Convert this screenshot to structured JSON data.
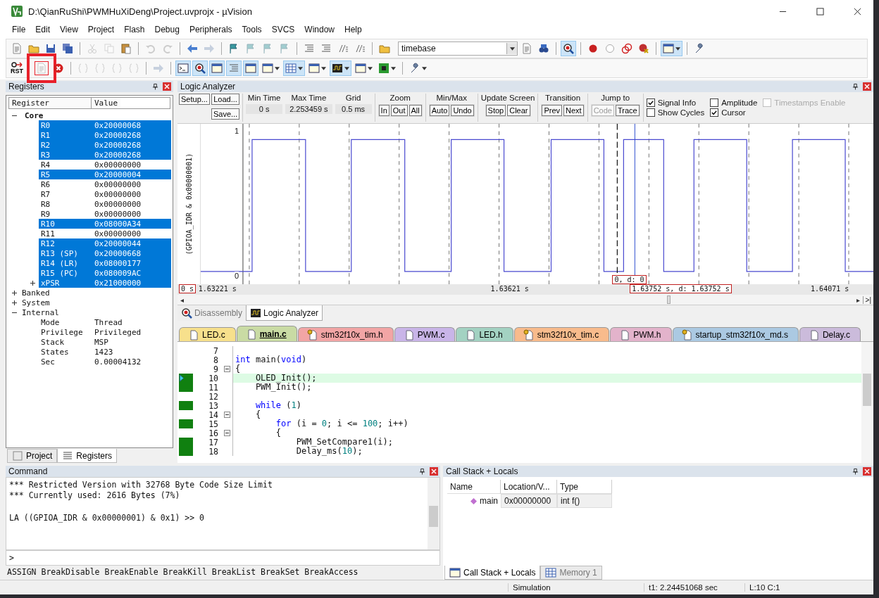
{
  "window": {
    "title": "D:\\QianRuShi\\PWMHuXiDeng\\Project.uvprojx - µVision"
  },
  "menu": [
    "File",
    "Edit",
    "View",
    "Project",
    "Flash",
    "Debug",
    "Peripherals",
    "Tools",
    "SVCS",
    "Window",
    "Help"
  ],
  "toolbar_1": [
    {
      "buttons": [
        {
          "kind": "plain",
          "pressed": false,
          "disabled": false
        },
        {
          "kind": "plain",
          "pressed": false,
          "disabled": false
        },
        {
          "kind": "plain",
          "pressed": false,
          "disabled": false
        },
        {
          "kind": "plain",
          "pressed": false,
          "disabled": false
        }
      ]
    },
    {
      "buttons": [
        {
          "kind": "plain",
          "pressed": false,
          "disabled": true
        },
        {
          "kind": "plain",
          "pressed": false,
          "disabled": true
        },
        {
          "kind": "plain",
          "pressed": false,
          "disabled": false
        }
      ]
    },
    {
      "buttons": [
        {
          "kind": "plain",
          "pressed": false,
          "disabled": true
        },
        {
          "kind": "plain",
          "pressed": false,
          "disabled": true
        }
      ]
    },
    {
      "buttons": [
        {
          "kind": "plain",
          "pressed": false,
          "disabled": false
        },
        {
          "kind": "plain",
          "pressed": false,
          "disabled": true
        }
      ]
    },
    {
      "buttons": [
        {
          "kind": "plain",
          "pressed": false,
          "disabled": false
        },
        {
          "kind": "plain",
          "pressed": false,
          "disabled": true
        },
        {
          "kind": "plain",
          "pressed": false,
          "disabled": true
        },
        {
          "kind": "plain",
          "pressed": false,
          "disabled": true
        }
      ]
    },
    {
      "buttons": [
        {
          "kind": "plain",
          "pressed": false,
          "disabled": false
        },
        {
          "kind": "plain",
          "pressed": false,
          "disabled": false
        },
        {
          "kind": "plain",
          "pressed": false,
          "disabled": false
        },
        {
          "kind": "plain",
          "pressed": false,
          "disabled": false
        }
      ]
    },
    {
      "buttons": [
        {
          "kind": "plain",
          "pressed": false,
          "disabled": false
        },
        {
          "kind": "field",
          "value": "timebase"
        },
        {
          "kind": "plain",
          "pressed": false,
          "disabled": false
        },
        {
          "kind": "plain",
          "pressed": false,
          "disabled": false
        }
      ]
    },
    {
      "buttons": [
        {
          "kind": "plain",
          "pressed": true,
          "disabled": false
        }
      ]
    },
    {
      "buttons": [
        {
          "kind": "plain",
          "pressed": false,
          "disabled": false
        },
        {
          "kind": "plain",
          "pressed": false,
          "disabled": false
        },
        {
          "kind": "plain",
          "pressed": false,
          "disabled": false
        },
        {
          "kind": "plain",
          "pressed": false,
          "disabled": false
        }
      ]
    },
    {
      "buttons": [
        {
          "kind": "split",
          "pressed": true,
          "disabled": false
        }
      ]
    },
    {
      "buttons": [
        {
          "kind": "plain",
          "pressed": false,
          "disabled": false
        }
      ]
    }
  ],
  "toolbar_2": [
    {
      "buttons": [
        {
          "kind": "labelled",
          "label": "RST",
          "pressed": false,
          "disabled": false,
          "highlighted": false
        }
      ]
    },
    {
      "buttons": [
        {
          "kind": "plain",
          "pressed": false,
          "disabled": true,
          "highlighted": true
        },
        {
          "kind": "plain",
          "pressed": false,
          "disabled": false,
          "highlighted": false
        }
      ]
    },
    {
      "buttons": [
        {
          "kind": "plain",
          "pressed": false,
          "disabled": true,
          "highlighted": false
        },
        {
          "kind": "plain",
          "pressed": false,
          "disabled": true,
          "highlighted": false
        },
        {
          "kind": "plain",
          "pressed": false,
          "disabled": true,
          "highlighted": false
        },
        {
          "kind": "plain",
          "pressed": false,
          "disabled": true,
          "highlighted": false
        }
      ]
    },
    {
      "buttons": [
        {
          "kind": "plain",
          "pressed": false,
          "disabled": true,
          "highlighted": false
        }
      ]
    },
    {
      "buttons": [
        {
          "kind": "plain",
          "pressed": true,
          "disabled": false,
          "highlighted": false
        },
        {
          "kind": "plain",
          "pressed": true,
          "disabled": false,
          "highlighted": false
        },
        {
          "kind": "plain",
          "pressed": true,
          "disabled": false,
          "highlighted": false
        },
        {
          "kind": "plain",
          "pressed": true,
          "disabled": false,
          "highlighted": false
        },
        {
          "kind": "plain",
          "pressed": true,
          "disabled": false,
          "highlighted": false
        },
        {
          "kind": "split",
          "pressed": false,
          "disabled": false,
          "highlighted": false
        },
        {
          "kind": "split",
          "pressed": true,
          "disabled": false,
          "highlighted": false
        },
        {
          "kind": "split",
          "pressed": false,
          "disabled": false,
          "highlighted": false
        },
        {
          "kind": "split",
          "pressed": true,
          "disabled": false,
          "highlighted": false
        },
        {
          "kind": "split",
          "pressed": false,
          "disabled": false,
          "highlighted": false
        },
        {
          "kind": "split",
          "pressed": false,
          "disabled": false,
          "highlighted": false
        }
      ]
    },
    {
      "buttons": [
        {
          "kind": "split",
          "pressed": false,
          "disabled": false,
          "highlighted": false
        }
      ]
    }
  ],
  "registers": {
    "title": "Registers",
    "columns": [
      "Register",
      "Value"
    ],
    "groups": [
      {
        "name": "Core",
        "expanded": true,
        "children": [
          {
            "name": "R0",
            "value": "0x20000068",
            "selected": true
          },
          {
            "name": "R1",
            "value": "0x20000268",
            "selected": true
          },
          {
            "name": "R2",
            "value": "0x20000268",
            "selected": true
          },
          {
            "name": "R3",
            "value": "0x20000268",
            "selected": true
          },
          {
            "name": "R4",
            "value": "0x00000000",
            "selected": false
          },
          {
            "name": "R5",
            "value": "0x20000004",
            "selected": true
          },
          {
            "name": "R6",
            "value": "0x00000000",
            "selected": false
          },
          {
            "name": "R7",
            "value": "0x00000000",
            "selected": false
          },
          {
            "name": "R8",
            "value": "0x00000000",
            "selected": false
          },
          {
            "name": "R9",
            "value": "0x00000000",
            "selected": false
          },
          {
            "name": "R10",
            "value": "0x08000A34",
            "selected": true
          },
          {
            "name": "R11",
            "value": "0x00000000",
            "selected": false
          },
          {
            "name": "R12",
            "value": "0x20000044",
            "selected": true
          },
          {
            "name": "R13 (SP)",
            "value": "0x20000668",
            "selected": true
          },
          {
            "name": "R14 (LR)",
            "value": "0x08000177",
            "selected": true
          },
          {
            "name": "R15 (PC)",
            "value": "0x080009AC",
            "selected": true
          },
          {
            "name": "xPSR",
            "value": "0x21000000",
            "selected": true,
            "expanded": false
          }
        ]
      },
      {
        "name": "Banked",
        "expanded": false
      },
      {
        "name": "System",
        "expanded": false
      },
      {
        "name": "Internal",
        "expanded": true,
        "children": [
          {
            "name": "Mode",
            "value": "Thread",
            "selected": false
          },
          {
            "name": "Privilege",
            "value": "Privileged",
            "selected": false
          },
          {
            "name": "Stack",
            "value": "MSP",
            "selected": false
          },
          {
            "name": "States",
            "value": "1423",
            "selected": false
          },
          {
            "name": "Sec",
            "value": "0.00004132",
            "selected": false
          }
        ]
      }
    ],
    "tabs": [
      {
        "label": "Project",
        "selected": false
      },
      {
        "label": "Registers",
        "selected": true
      }
    ]
  },
  "logic_analyzer": {
    "title": "Logic Analyzer",
    "file_buttons": [
      "Setup...",
      "Load...",
      "Save..."
    ],
    "readouts": [
      {
        "label": "Min Time",
        "value": "0 s"
      },
      {
        "label": "Max Time",
        "value": "2.253459 s"
      },
      {
        "label": "Grid",
        "value": "0.5 ms"
      }
    ],
    "button_groups": [
      {
        "label": "Zoom",
        "buttons": [
          {
            "label": "In",
            "disabled": false
          },
          {
            "label": "Out",
            "disabled": false
          },
          {
            "label": "All",
            "disabled": false
          }
        ]
      },
      {
        "label": "Min/Max",
        "buttons": [
          {
            "label": "Auto",
            "disabled": false
          },
          {
            "label": "Undo",
            "disabled": false
          }
        ]
      },
      {
        "label": "Update Screen",
        "buttons": [
          {
            "label": "Stop",
            "disabled": false
          },
          {
            "label": "Clear",
            "disabled": false
          }
        ]
      },
      {
        "label": "Transition",
        "buttons": [
          {
            "label": "Prev",
            "disabled": false
          },
          {
            "label": "Next",
            "disabled": false
          }
        ]
      },
      {
        "label": "Jump to",
        "buttons": [
          {
            "label": "Code",
            "disabled": true
          },
          {
            "label": "Trace",
            "disabled": false
          }
        ]
      }
    ],
    "options": [
      {
        "label": "Signal Info",
        "checked": true,
        "disabled": false
      },
      {
        "label": "Amplitude",
        "checked": false,
        "disabled": false
      },
      {
        "label": "Timestamps Enable",
        "checked": false,
        "disabled": true
      },
      {
        "label": "Show Cycles",
        "checked": false,
        "disabled": false
      },
      {
        "label": "Cursor",
        "checked": true,
        "disabled": false
      }
    ],
    "signal": "(GPIOA_IDR & 0x00000001)",
    "y_high": "1",
    "y_low": "0",
    "cursor_readout": "0,  d: 0",
    "time_labels": [
      {
        "text": "0 s",
        "boxed": true
      },
      {
        "text": "1.63221 s",
        "boxed": false
      },
      {
        "text": "1.63621 s",
        "boxed": false
      },
      {
        "text": "1.63752 s,  d: 1.63752 s",
        "boxed": true
      },
      {
        "text": "1.64071 s",
        "boxed": false
      }
    ],
    "scroll_left": "◂",
    "scroll_right": "▸",
    "scroll_end": ">|",
    "tabs": [
      {
        "label": "Disassembly",
        "selected": false
      },
      {
        "label": "Logic Analyzer",
        "selected": true
      }
    ]
  },
  "editor": {
    "tabs": [
      {
        "label": "LED.c",
        "color": "#f7e08c",
        "selected": false,
        "read_only": false
      },
      {
        "label": "main.c",
        "color": "#c9dba4",
        "selected": true,
        "read_only": false
      },
      {
        "label": "stm32f10x_tim.h",
        "color": "#f2a5a5",
        "selected": false,
        "read_only": true
      },
      {
        "label": "PWM.c",
        "color": "#c9b5e8",
        "selected": false,
        "read_only": false
      },
      {
        "label": "LED.h",
        "color": "#a3d2c2",
        "selected": false,
        "read_only": false
      },
      {
        "label": "stm32f10x_tim.c",
        "color": "#f8bb8c",
        "selected": false,
        "read_only": true
      },
      {
        "label": "PWM.h",
        "color": "#e3b3cb",
        "selected": false,
        "read_only": false
      },
      {
        "label": "startup_stm32f10x_md.s",
        "color": "#abc9e2",
        "selected": false,
        "read_only": true
      },
      {
        "label": "Delay.c",
        "color": "#cbbbdb",
        "selected": false,
        "read_only": false
      }
    ],
    "lines": [
      {
        "number": "7",
        "executed": false,
        "fold": false
      },
      {
        "number": "8",
        "executed": false,
        "current": false,
        "fold": false,
        "segments": [
          {
            "text": "int",
            "kind": "keyword"
          },
          {
            "text": " main(",
            "kind": "plain"
          },
          {
            "text": "void",
            "kind": "keyword"
          },
          {
            "text": ")",
            "kind": "plain"
          }
        ]
      },
      {
        "number": "9",
        "executed": false,
        "current": false,
        "fold": true,
        "segments": [
          {
            "text": "{",
            "kind": "plain"
          }
        ]
      },
      {
        "number": "10",
        "executed": true,
        "current": true,
        "fold": false,
        "segments": [
          {
            "text": "    OLED_Init();",
            "kind": "plain"
          }
        ]
      },
      {
        "number": "11",
        "executed": true,
        "current": false,
        "fold": false,
        "segments": [
          {
            "text": "    PWM_Init();",
            "kind": "plain"
          }
        ]
      },
      {
        "number": "12",
        "executed": false,
        "fold": false
      },
      {
        "number": "13",
        "executed": true,
        "current": false,
        "fold": false,
        "segments": [
          {
            "text": "    while",
            "kind": "keyword"
          },
          {
            "text": " (",
            "kind": "plain"
          },
          {
            "text": "1",
            "kind": "number"
          },
          {
            "text": ")",
            "kind": "plain"
          }
        ]
      },
      {
        "number": "14",
        "executed": false,
        "current": false,
        "fold": true,
        "segments": [
          {
            "text": "    {",
            "kind": "plain"
          }
        ]
      },
      {
        "number": "15",
        "executed": true,
        "current": false,
        "fold": false,
        "segments": [
          {
            "text": "        for",
            "kind": "keyword"
          },
          {
            "text": " (i = ",
            "kind": "plain"
          },
          {
            "text": "0",
            "kind": "number"
          },
          {
            "text": "; i <= ",
            "kind": "plain"
          },
          {
            "text": "100",
            "kind": "number"
          },
          {
            "text": "; i++)",
            "kind": "plain"
          }
        ]
      },
      {
        "number": "16",
        "executed": false,
        "current": false,
        "fold": true,
        "segments": [
          {
            "text": "        {",
            "kind": "plain"
          }
        ]
      },
      {
        "number": "17",
        "executed": true,
        "current": false,
        "fold": false,
        "segments": [
          {
            "text": "            PWM_SetCompare1(i);",
            "kind": "plain"
          }
        ]
      },
      {
        "number": "18",
        "executed": true,
        "current": false,
        "fold": false,
        "segments": [
          {
            "text": "            Delay_ms(",
            "kind": "plain"
          },
          {
            "text": "10",
            "kind": "number"
          },
          {
            "text": ");",
            "kind": "plain"
          }
        ]
      }
    ]
  },
  "command": {
    "title": "Command",
    "output": [
      {
        "text": "*** Restricted Version with 32768 Byte Code Size Limit",
        "kind": "info"
      },
      {
        "text": "*** Currently used: 2616 Bytes (7%)",
        "kind": "info"
      },
      {
        "text": "LA ((GPIOA_IDR & 0x00000001) & 0x1) >> 0",
        "kind": "command"
      }
    ],
    "prompt": ">",
    "hint": "ASSIGN BreakDisable BreakEnable BreakKill BreakList BreakSet BreakAccess"
  },
  "call_stack": {
    "title": "Call Stack + Locals",
    "columns": [
      "Name",
      "Location/V...",
      "Type"
    ],
    "rows": [
      {
        "name": "main",
        "location": "0x00000000",
        "type": "int f()"
      }
    ],
    "tabs": [
      {
        "label": "Call Stack + Locals",
        "selected": true
      },
      {
        "label": "Memory 1",
        "selected": false
      }
    ]
  },
  "status_bar": {
    "mode": "Simulation",
    "time": "t1: 2.24451068 sec",
    "position": "L:10 C:1"
  }
}
